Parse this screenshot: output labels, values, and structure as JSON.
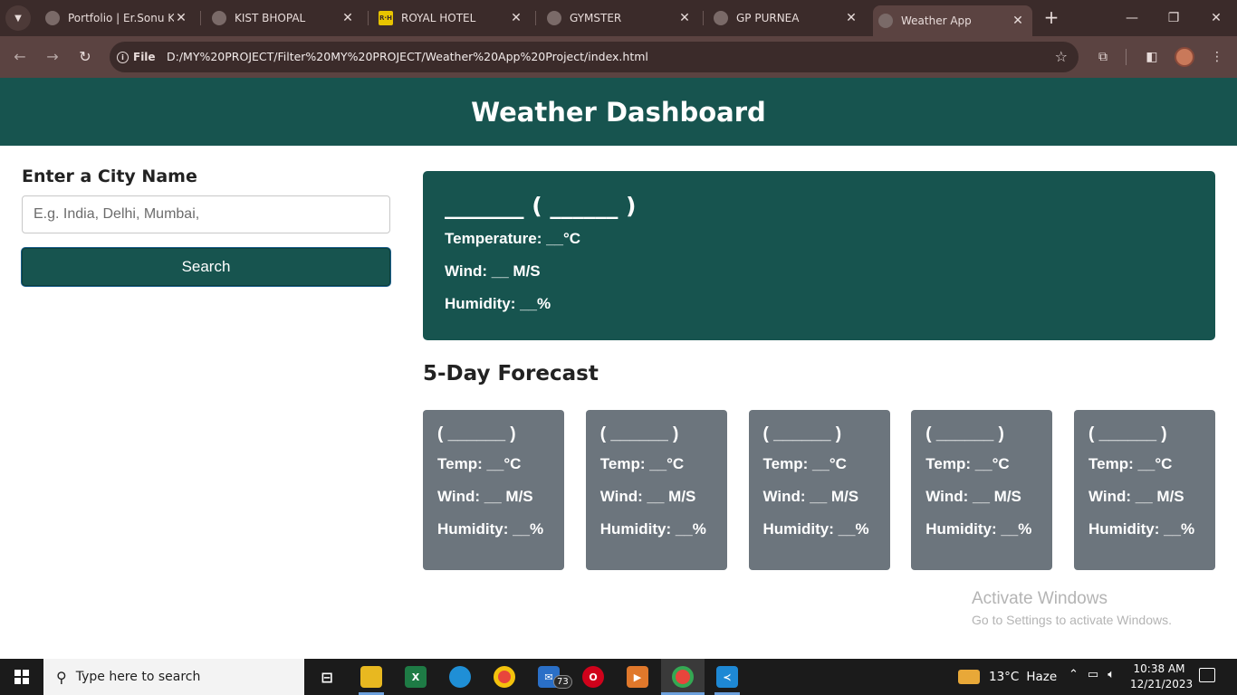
{
  "browser": {
    "tabs": [
      {
        "title": "Portfolio | Er.Sonu Ku",
        "icon": "globe-icon"
      },
      {
        "title": "KIST BHOPAL",
        "icon": "globe-icon"
      },
      {
        "title": "ROYAL HOTEL",
        "icon": "rh-logo-icon"
      },
      {
        "title": "GYMSTER",
        "icon": "globe-icon"
      },
      {
        "title": "GP PURNEA",
        "icon": "globe-icon"
      },
      {
        "title": "Weather App",
        "icon": "globe-icon",
        "active": true
      }
    ],
    "site_chip": "File",
    "url": "D:/MY%20PROJECT/Filter%20MY%20PROJECT/Weather%20App%20Project/index.html"
  },
  "page": {
    "header_title": "Weather Dashboard",
    "city_label": "Enter a City Name",
    "city_placeholder": "E.g. India, Delhi, Mumbai,",
    "search_button": "Search",
    "current": {
      "heading": "_______ ( ______ )",
      "temperature": "Temperature: __°C",
      "wind": "Wind: __ M/S",
      "humidity": "Humidity: __%"
    },
    "forecast_title": "5-Day Forecast",
    "forecast": [
      {
        "date": "( ______ )",
        "temp": "Temp: __°C",
        "wind": "Wind: __ M/S",
        "humidity": "Humidity: __%"
      },
      {
        "date": "( ______ )",
        "temp": "Temp: __°C",
        "wind": "Wind: __ M/S",
        "humidity": "Humidity: __%"
      },
      {
        "date": "( ______ )",
        "temp": "Temp: __°C",
        "wind": "Wind: __ M/S",
        "humidity": "Humidity: __%"
      },
      {
        "date": "( ______ )",
        "temp": "Temp: __°C",
        "wind": "Wind: __ M/S",
        "humidity": "Humidity: __%"
      },
      {
        "date": "( ______ )",
        "temp": "Temp: __°C",
        "wind": "Wind: __ M/S",
        "humidity": "Humidity: __%"
      }
    ],
    "watermark_line1": "Activate Windows",
    "watermark_line2": "Go to Settings to activate Windows."
  },
  "taskbar": {
    "search_placeholder": "Type here to search",
    "mail_badge": "73",
    "weather_temp": "13°C",
    "weather_condition": "Haze",
    "time": "10:38 AM",
    "date": "12/21/2023"
  },
  "colors": {
    "header_bg": "#17544f",
    "forecast_card_bg": "#6c757d",
    "browser_frame": "#3b2b2a"
  }
}
